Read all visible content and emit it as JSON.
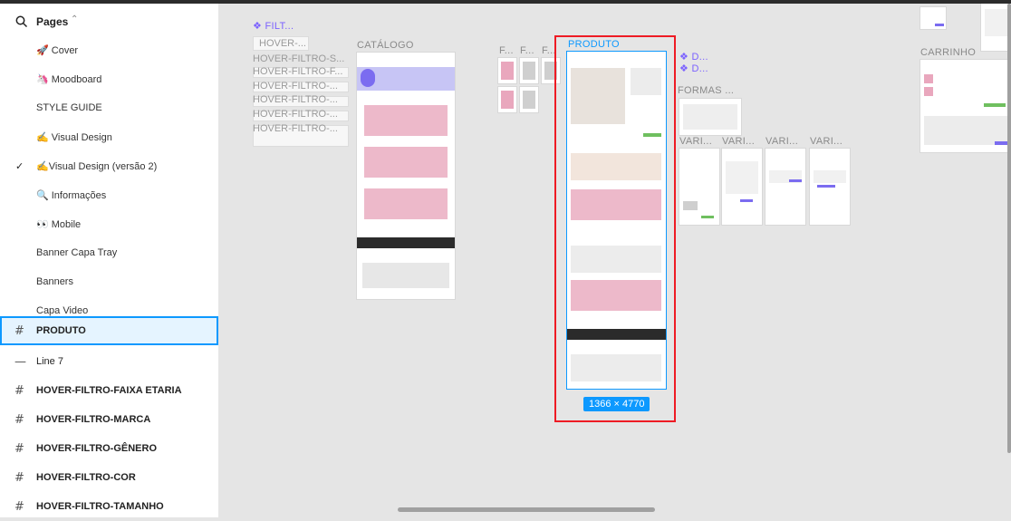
{
  "sidebar": {
    "header": {
      "title": "Pages"
    },
    "pages": [
      {
        "label": "🚀 Cover"
      },
      {
        "label": "🦄 Moodboard"
      },
      {
        "label": "STYLE GUIDE"
      },
      {
        "label": "✍️ Visual Design"
      },
      {
        "label": "✍️Visual Design (versão 2)",
        "current": true
      },
      {
        "label": "🔍 Informações"
      },
      {
        "label": "👀 Mobile"
      },
      {
        "label": "Banner Capa Tray"
      },
      {
        "label": "Banners"
      },
      {
        "label": "Capa Video"
      }
    ],
    "layers": [
      {
        "label": "PRODUTO",
        "icon": "#",
        "selected": true
      },
      {
        "label": "Line 7",
        "icon": "—",
        "bold": false
      },
      {
        "label": "HOVER-FILTRO-FAIXA ETARIA",
        "icon": "#"
      },
      {
        "label": "HOVER-FILTRO-MARCA",
        "icon": "#"
      },
      {
        "label": "HOVER-FILTRO-GÊNERO",
        "icon": "#"
      },
      {
        "label": "HOVER-FILTRO-COR",
        "icon": "#"
      },
      {
        "label": "HOVER-FILTRO-TAMANHO",
        "icon": "#"
      }
    ]
  },
  "canvas": {
    "labels": {
      "filt": "❖ FILT...",
      "hover1": "HOVER-...",
      "hover2": "HOVER-FILTRO-S...",
      "hover3": "HOVER-FILTRO-F...",
      "hover4": "HOVER-FILTRO-...",
      "hover5": "HOVER-FILTRO-...",
      "hover6": "HOVER-FILTRO-...",
      "hover7": "HOVER-FILTRO-...",
      "catalogo": "CATÁLOGO",
      "f1": "F...",
      "f2": "F...",
      "f3": "F...",
      "produto": "PRODUTO",
      "d1": "❖ D...",
      "d2": "❖ D...",
      "formas": "FORMAS ...",
      "vari1": "VARI...",
      "vari2": "VARI...",
      "vari3": "VARI...",
      "vari4": "VARI...",
      "carrinho": "CARRINHO"
    },
    "dimensions": "1366 × 4770"
  }
}
